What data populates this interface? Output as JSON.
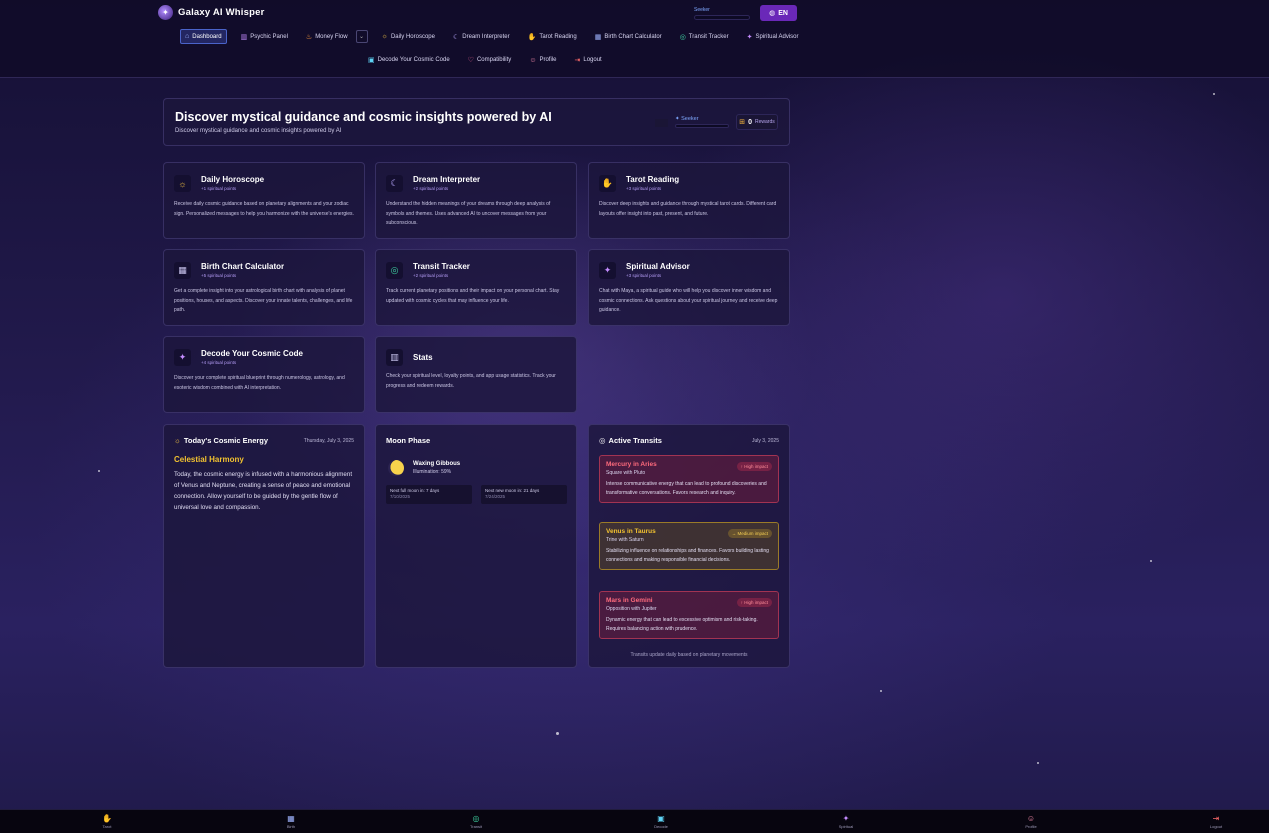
{
  "brand": {
    "name": "Galaxy AI Whisper"
  },
  "header": {
    "seeker_label": "Seeker",
    "lang_label": "EN",
    "nav_row1": [
      {
        "label": "Dashboard",
        "icon": "home-icon",
        "glyph": "⌂",
        "color": "#9fb4ff"
      },
      {
        "label": "Psychic Panel",
        "icon": "chart-icon",
        "glyph": "▥",
        "color": "#c48cff"
      },
      {
        "label": "Money Flow",
        "icon": "flame-icon",
        "glyph": "♨",
        "color": "#ff9a3c"
      },
      {
        "label": "Daily Horoscope",
        "icon": "sun-icon",
        "glyph": "☼",
        "color": "#f5c542"
      },
      {
        "label": "Dream Interpreter",
        "icon": "moon-icon",
        "glyph": "☾",
        "color": "#b9a8ff"
      },
      {
        "label": "Tarot Reading",
        "icon": "cards-icon",
        "glyph": "✋",
        "color": "#f5a623"
      },
      {
        "label": "Birth Chart Calculator",
        "icon": "calendar-icon",
        "glyph": "▦",
        "color": "#9fb4ff"
      },
      {
        "label": "Transit Tracker",
        "icon": "compass-icon",
        "glyph": "◎",
        "color": "#3fd6a3"
      },
      {
        "label": "Spiritual Advisor",
        "icon": "sparkle-icon",
        "glyph": "✦",
        "color": "#c48cff"
      }
    ],
    "nav_row2": [
      {
        "label": "Decode Your Cosmic Code",
        "icon": "grid-icon",
        "glyph": "▣",
        "color": "#5fd3f5"
      },
      {
        "label": "Compatibility",
        "icon": "heart-icon",
        "glyph": "♡",
        "color": "#ff6b9a"
      },
      {
        "label": "Profile",
        "icon": "user-icon",
        "glyph": "☺",
        "color": "#ff8fb1"
      },
      {
        "label": "Logout",
        "icon": "logout-icon",
        "glyph": "⇥",
        "color": "#ff6b6b"
      }
    ]
  },
  "hero": {
    "title": "Discover mystical guidance and cosmic insights powered by AI",
    "subtitle": "Discover mystical guidance and cosmic insights powered by AI",
    "seeker_label": "Seeker",
    "rewards_count": "0",
    "rewards_label": "Rewards"
  },
  "features": [
    {
      "title": "Daily Horoscope",
      "points": "+1 spiritual points",
      "desc": "Receive daily cosmic guidance based on planetary alignments and your zodiac sign. Personalized messages to help you harmonize with the universe's energies.",
      "icon": "sun-icon",
      "glyph": "☼",
      "color": "#f5c542"
    },
    {
      "title": "Dream Interpreter",
      "points": "+2 spiritual points",
      "desc": "Understand the hidden meanings of your dreams through deep analysis of symbols and themes. Uses advanced AI to uncover messages from your subconscious.",
      "icon": "moon-icon",
      "glyph": "☾",
      "color": "#b9a8ff"
    },
    {
      "title": "Tarot Reading",
      "points": "+3 spiritual points",
      "desc": "Discover deep insights and guidance through mystical tarot cards. Different card layouts offer insight into past, present, and future.",
      "icon": "cards-icon",
      "glyph": "✋",
      "color": "#f5a623"
    },
    {
      "title": "Birth Chart Calculator",
      "points": "+5 spiritual points",
      "desc": "Get a complete insight into your astrological birth chart with analysis of planet positions, houses, and aspects. Discover your innate talents, challenges, and life path.",
      "icon": "calendar-icon",
      "glyph": "▦",
      "color": "#c9c4ee"
    },
    {
      "title": "Transit Tracker",
      "points": "+2 spiritual points",
      "desc": "Track current planetary positions and their impact on your personal chart. Stay updated with cosmic cycles that may influence your life.",
      "icon": "compass-icon",
      "glyph": "◎",
      "color": "#3fd6a3"
    },
    {
      "title": "Spiritual Advisor",
      "points": "+3 spiritual points",
      "desc": "Chat with Maya, a spiritual guide who will help you discover inner wisdom and cosmic connections. Ask questions about your spiritual journey and receive deep guidance.",
      "icon": "sparkle-icon",
      "glyph": "✦",
      "color": "#c48cff"
    },
    {
      "title": "Decode Your Cosmic Code",
      "points": "+4 spiritual points",
      "desc": "Discover your complete spiritual blueprint through numerology, astrology, and esoteric wisdom combined with AI interpretation.",
      "icon": "sparkles-icon",
      "glyph": "✦",
      "color": "#c48cff"
    }
  ],
  "stats_card": {
    "title": "Stats",
    "desc": "Check your spiritual level, loyalty points, and app usage statistics. Track your progress and redeem rewards.",
    "icon": "bar-chart-icon",
    "glyph": "▥",
    "color": "#c9c4ee"
  },
  "cosmic_energy": {
    "title": "Today's Cosmic Energy",
    "date": "Thursday, July 3, 2025",
    "name": "Celestial Harmony",
    "text": "Today, the cosmic energy is infused with a harmonious alignment of Venus and Neptune, creating a sense of peace and emotional connection. Allow yourself to be guided by the gentle flow of universal love and compassion."
  },
  "moon": {
    "title": "Moon Phase",
    "phase": "Waxing Gibbous",
    "illumination": "Illumination: 59%",
    "next_full": "Next full moon in: 7 days",
    "next_full_date": "7/10/2025",
    "next_new": "Next new moon in: 21 days",
    "next_new_date": "7/24/2025"
  },
  "transits": {
    "title": "Active Transits",
    "date": "July 3, 2025",
    "items": [
      {
        "name": "Mercury in Aries",
        "aspect": "Square with Pluto",
        "impact": "High impact",
        "level": "high",
        "desc": "Intense communicative energy that can lead to profound discoveries and transformative conversations. Favors research and inquiry."
      },
      {
        "name": "Venus in Taurus",
        "aspect": "Trine with Saturn",
        "impact": "Medium impact",
        "level": "med",
        "desc": "Stabilizing influence on relationships and finances. Favors building lasting connections and making responsible financial decisions."
      },
      {
        "name": "Mars in Gemini",
        "aspect": "Opposition with Jupiter",
        "impact": "High impact",
        "level": "high",
        "desc": "Dynamic energy that can lead to excessive optimism and risk-taking. Requires balancing action with prudence."
      }
    ],
    "footer": "Transits update daily based on planetary movements"
  },
  "bottom_nav": [
    {
      "label": "Tarot",
      "icon": "cards-icon",
      "glyph": "✋",
      "color": "#f5a623"
    },
    {
      "label": "Birth",
      "icon": "calendar-icon",
      "glyph": "▦",
      "color": "#9fb4ff"
    },
    {
      "label": "Transit",
      "icon": "compass-icon",
      "glyph": "◎",
      "color": "#3fd6a3"
    },
    {
      "label": "Decode",
      "icon": "grid-icon",
      "glyph": "▣",
      "color": "#5fd3f5"
    },
    {
      "label": "Spiritual",
      "icon": "sparkle-icon",
      "glyph": "✦",
      "color": "#c48cff"
    },
    {
      "label": "Profile",
      "icon": "user-icon",
      "glyph": "☺",
      "color": "#ff8fb1"
    },
    {
      "label": "Logout",
      "icon": "logout-icon",
      "glyph": "⇥",
      "color": "#ff6b6b"
    }
  ]
}
